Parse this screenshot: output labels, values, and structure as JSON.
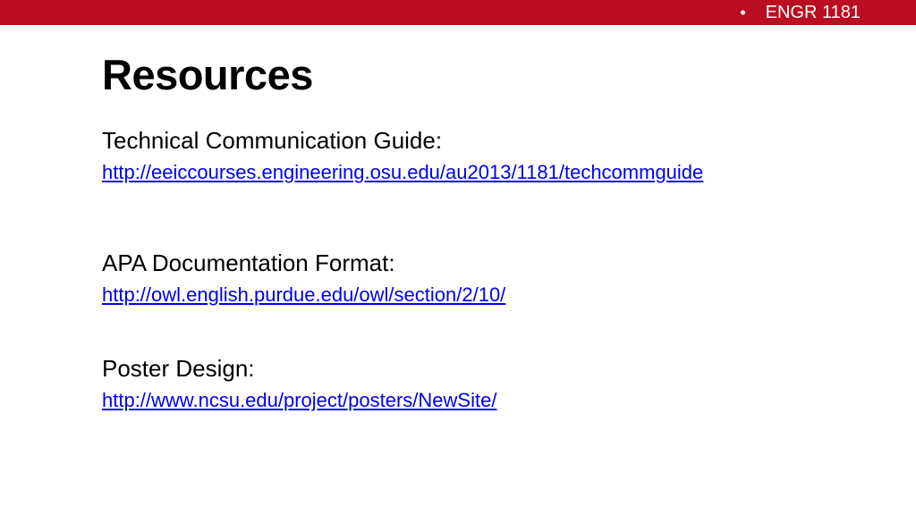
{
  "header": {
    "bullet": "•",
    "course": "ENGR 1181",
    "bar_color": "#bb0e20"
  },
  "title": "Resources",
  "resources": [
    {
      "label": "Technical Communication Guide:",
      "url": "http://eeiccourses.engineering.osu.edu/au2013/1181/techcommguide"
    },
    {
      "label": "APA Documentation Format:",
      "url": "http://owl.english.purdue.edu/owl/section/2/10/"
    },
    {
      "label": "Poster Design:",
      "url": "http://www.ncsu.edu/project/posters/NewSite/"
    }
  ],
  "colors": {
    "link": "#0000ee",
    "text": "#000000"
  }
}
